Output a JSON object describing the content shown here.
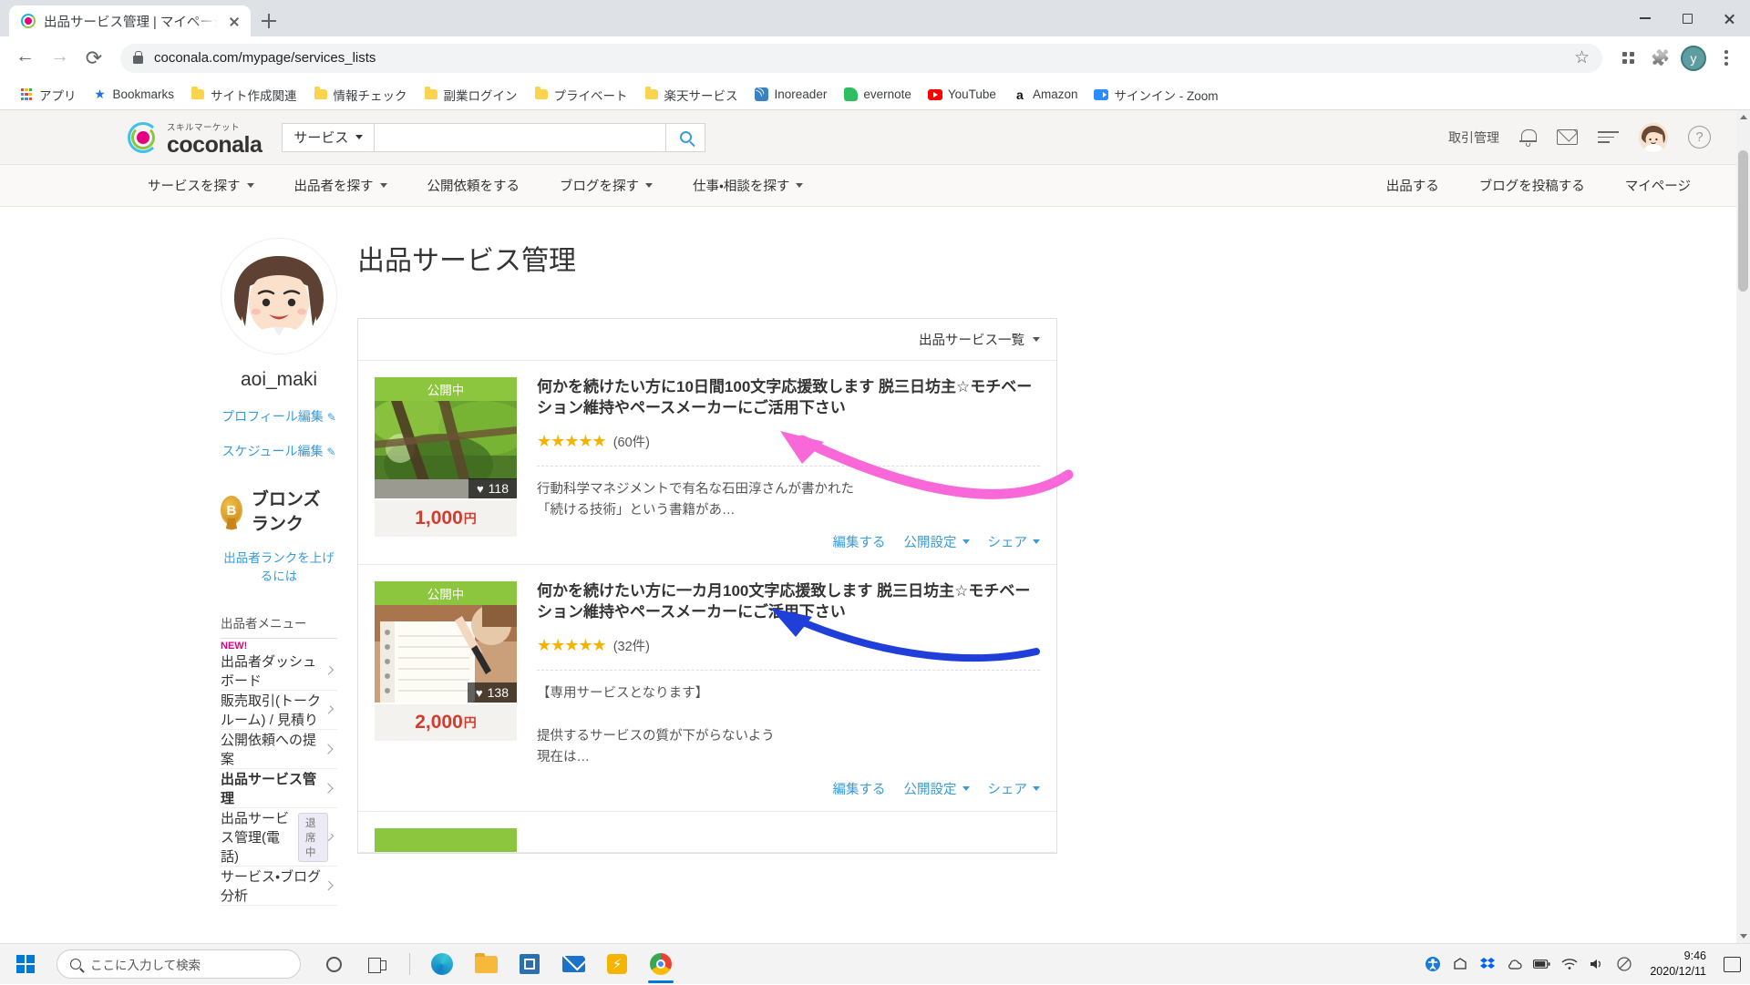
{
  "browser": {
    "tab": {
      "title": "出品サービス管理 | マイページ | ココナ",
      "favicon": "coconala-favicon"
    },
    "new_tab_label": "+",
    "url": "coconala.com/mypage/services_lists",
    "profile_initial": "y",
    "bookmarks": [
      {
        "label": "アプリ",
        "icon": "apps-grid-icon"
      },
      {
        "label": "Bookmarks",
        "icon": "star-icon"
      },
      {
        "label": "サイト作成関連",
        "icon": "folder-icon"
      },
      {
        "label": "情報チェック",
        "icon": "folder-icon"
      },
      {
        "label": "副業ログイン",
        "icon": "folder-icon"
      },
      {
        "label": "プライベート",
        "icon": "folder-icon"
      },
      {
        "label": "楽天サービス",
        "icon": "folder-icon"
      },
      {
        "label": "Inoreader",
        "icon": "rss-icon"
      },
      {
        "label": "evernote",
        "icon": "evernote-icon"
      },
      {
        "label": "YouTube",
        "icon": "youtube-icon"
      },
      {
        "label": "Amazon",
        "icon": "amazon-icon"
      },
      {
        "label": "サインイン - Zoom",
        "icon": "zoom-icon"
      }
    ]
  },
  "site": {
    "logo_tagline": "スキルマーケット",
    "logo_name": "coconala",
    "category_select": "サービス",
    "search_value": "",
    "search_placeholder": "",
    "header_links": [
      {
        "label": "取引管理"
      }
    ],
    "header_icons": [
      "bell-icon",
      "mail-icon",
      "list-icon",
      "user-avatar",
      "help-icon"
    ],
    "nav": [
      {
        "label": "サービスを探す",
        "caret": true
      },
      {
        "label": "出品者を探す",
        "caret": true
      },
      {
        "label": "公開依頼をする",
        "caret": false
      },
      {
        "label": "ブログを探す",
        "caret": true
      },
      {
        "label": "仕事・相談を探す",
        "caret": true
      }
    ],
    "nav_right": [
      {
        "label": "出品する"
      },
      {
        "label": "ブログを投稿する"
      },
      {
        "label": "マイページ"
      }
    ]
  },
  "sidebar": {
    "username": "aoi_maki",
    "profile_edit": "プロフィール編集",
    "schedule_edit": "スケジュール編集",
    "rank_badge_letter": "B",
    "rank_label": "ブロンズランク",
    "rank_up_link": "出品者ランクを上げるには",
    "menu_title": "出品者メニュー",
    "items": [
      {
        "label": "出品者ダッシュボード",
        "new": "NEW!",
        "bold": false,
        "pill": ""
      },
      {
        "label": "販売取引(トークルーム) / 見積り",
        "new": "",
        "bold": false,
        "pill": ""
      },
      {
        "label": "公開依頼への提案",
        "new": "",
        "bold": false,
        "pill": ""
      },
      {
        "label": "出品サービス管理",
        "new": "",
        "bold": true,
        "pill": ""
      },
      {
        "label": "出品サービス管理(電話)",
        "new": "",
        "bold": false,
        "pill": "退席中"
      },
      {
        "label": "サービス・ブログ分析",
        "new": "",
        "bold": false,
        "pill": ""
      }
    ]
  },
  "main": {
    "page_title": "出品サービス管理",
    "panel_filter": "出品サービス一覧",
    "services": [
      {
        "status": "公開中",
        "title": "何かを続けたい方に10日間100文字応援致します 脱三日坊主☆モチベーション維持やペースメーカーにご活用下さい",
        "stars": "★★★★★",
        "review_count": "(60件)",
        "favorites": "118",
        "price": "1,000",
        "currency": "円",
        "description": "行動科学マネジメントで有名な石田淳さんが書かれた\n「続ける技術」という書籍があ…",
        "actions": [
          {
            "label": "編集する",
            "caret": false
          },
          {
            "label": "公開設定",
            "caret": true
          },
          {
            "label": "シェア",
            "caret": true
          }
        ],
        "thumb_kind": "green-trellis"
      },
      {
        "status": "公開中",
        "title": "何かを続けたい方に一カ月100文字応援致します 脱三日坊主☆モチベーション維持やペースメーカーにご活用下さい",
        "stars": "★★★★★",
        "review_count": "(32件)",
        "favorites": "138",
        "price": "2,000",
        "currency": "円",
        "description": "【専用サービスとなります】\n\n提供するサービスの質が下がらないよう\n現在は…",
        "actions": [
          {
            "label": "編集する",
            "caret": false
          },
          {
            "label": "公開設定",
            "caret": true
          },
          {
            "label": "シェア",
            "caret": true
          }
        ],
        "thumb_kind": "notebook"
      }
    ]
  },
  "annotations": [
    {
      "name": "pink-arrow",
      "color": "#f968d8"
    },
    {
      "name": "blue-arrow",
      "color": "#1f3fd8"
    }
  ],
  "taskbar": {
    "search_placeholder": "ここに入力して検索",
    "time": "9:46",
    "date": "2020/12/11",
    "apps": [
      "cortana-icon",
      "task-view-icon",
      "edge-icon",
      "file-explorer-icon",
      "microsoft-store-icon",
      "mail-icon",
      "thunderbolt-icon",
      "chrome-icon"
    ],
    "tray": [
      "accessibility-icon",
      "share-icon",
      "dropbox-icon",
      "cloud-icon",
      "battery-icon",
      "wifi-icon",
      "volume-icon",
      "no-entry-icon"
    ]
  }
}
